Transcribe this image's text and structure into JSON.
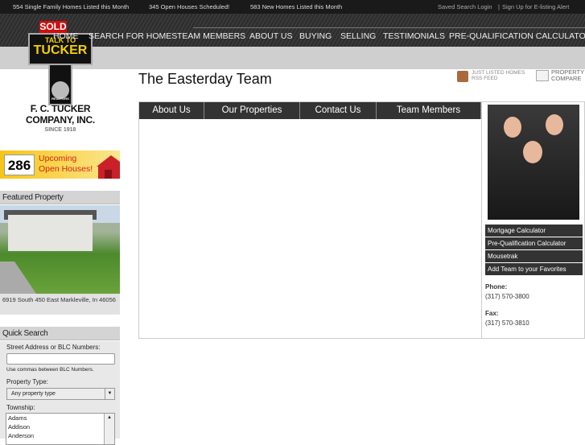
{
  "topbar": {
    "stat1": "554 Single Family Homes Listed this Month",
    "stat2": "345 Open Houses Scheduled!",
    "stat3": "583 New Homes Listed this Month",
    "login": "Saved Search Login",
    "separator": "|",
    "signup": "Sign Up for E-listing Alert"
  },
  "nav": [
    "HOME",
    "SEARCH FOR HOMES",
    "TEAM MEMBERS",
    "ABOUT US",
    "BUYING",
    "SELLING",
    "TESTIMONIALS",
    "PRE-QUALIFICATION CALCULATOR"
  ],
  "logo": {
    "sold": "SOLD",
    "talk": "TALK TO",
    "tucker": "TUCKER",
    "realtors": "REALTORS",
    "company1": "F. C. TUCKER",
    "company2": "COMPANY, INC.",
    "since": "SINCE 1918"
  },
  "openhouses": {
    "count": "286",
    "line1": "Upcoming",
    "line2": "Open Houses!"
  },
  "featured": {
    "heading": "Featured Property",
    "address": "6919 South 450 East Markleville, In 46056"
  },
  "quicksearch": {
    "heading": "Quick Search",
    "street_label": "Street Address or BLC Numbers:",
    "street_value": "",
    "hint": "Use commas between BLC Numbers.",
    "type_label": "Property Type:",
    "type_value": "Any property type",
    "township_label": "Township:",
    "townships": [
      "Adams",
      "Addison",
      "Anderson"
    ]
  },
  "page": {
    "title": "The Easterday Team",
    "rss1": "JUST LISTED HOMES",
    "rss2": "RSS FEED",
    "compare1": "PROPERTY",
    "compare2": "COMPARE"
  },
  "tabs": [
    "About Us",
    "Our Properties",
    "Contact Us",
    "Team Members"
  ],
  "sidebar": {
    "links": [
      "Mortgage Calculator",
      "Pre-Qualification Calculator",
      "Mousetrak",
      "Add Team to your Favorites"
    ],
    "phone_label": "Phone:",
    "phone": "(317) 570-3800",
    "fax_label": "Fax:",
    "fax": "(317) 570-3810"
  }
}
